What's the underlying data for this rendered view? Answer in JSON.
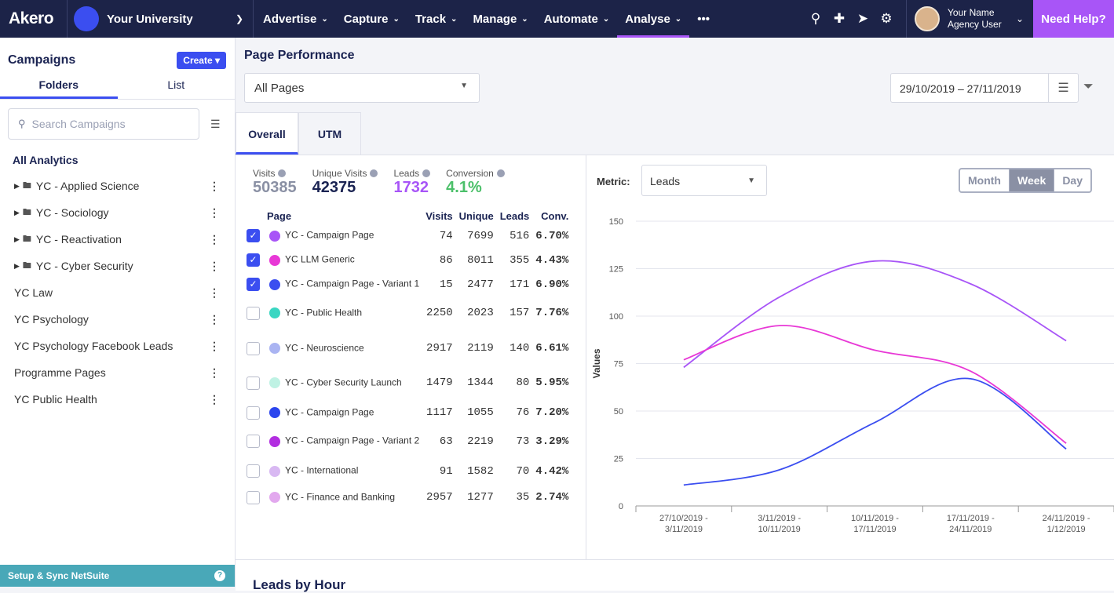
{
  "topbar": {
    "logo": "Akero",
    "org": "Your University",
    "nav": [
      "Advertise",
      "Capture",
      "Track",
      "Manage",
      "Automate",
      "Analyse"
    ],
    "more": "•••",
    "user_name": "Your Name",
    "user_role": "Agency User",
    "help": "Need Help?"
  },
  "sidebar": {
    "title": "Campaigns",
    "create": "Create ▾",
    "tabs": [
      "Folders",
      "List"
    ],
    "search_placeholder": "Search Campaigns",
    "all": "All Analytics",
    "folders": [
      "YC - Applied Science",
      "YC - Sociology",
      "YC - Reactivation",
      "YC - Cyber Security"
    ],
    "items": [
      "YC Law",
      "YC Psychology",
      "YC Psychology Facebook Leads",
      "Programme Pages",
      "YC Public Health"
    ],
    "footer": "Setup & Sync NetSuite"
  },
  "main": {
    "title": "Page Performance",
    "page_select": "All Pages",
    "date_range": "29/10/2019 – 27/11/2019",
    "tabs": [
      "Overall",
      "UTM"
    ],
    "stats": [
      {
        "label": "Visits",
        "value": "50385",
        "color": "#8a90a4"
      },
      {
        "label": "Unique Visits",
        "value": "42375",
        "color": "#1a2352"
      },
      {
        "label": "Leads",
        "value": "1732",
        "color": "#a855f7"
      },
      {
        "label": "Conversion",
        "value": "4.1%",
        "color": "#4cc06a"
      }
    ],
    "headers": [
      "Page",
      "Visits",
      "Unique",
      "Leads",
      "Conv."
    ],
    "rows": [
      {
        "checked": true,
        "color": "#a855f7",
        "page": "YC - Campaign Page",
        "visits": "74",
        "unique": "7699",
        "leads": "516",
        "conv": "6.70%"
      },
      {
        "checked": true,
        "color": "#e838d6",
        "page": "YC LLM Generic",
        "visits": "86",
        "unique": "8011",
        "leads": "355",
        "conv": "4.43%"
      },
      {
        "checked": true,
        "color": "#3b4ef0",
        "page": "YC - Campaign Page - Variant 1",
        "visits": "15",
        "unique": "2477",
        "leads": "171",
        "conv": "6.90%"
      },
      {
        "checked": false,
        "color": "#3ad6c2",
        "page": "YC - Public Health",
        "visits": "2250",
        "unique": "2023",
        "leads": "157",
        "conv": "7.76%"
      },
      {
        "checked": false,
        "color": "#aab4f2",
        "page": "YC - Neuroscience",
        "visits": "2917",
        "unique": "2119",
        "leads": "140",
        "conv": "6.61%"
      },
      {
        "checked": false,
        "color": "#bff2e4",
        "page": "YC - Cyber Security Launch",
        "visits": "1479",
        "unique": "1344",
        "leads": "80",
        "conv": "5.95%"
      },
      {
        "checked": false,
        "color": "#2b45ee",
        "page": "YC - Campaign Page",
        "visits": "1117",
        "unique": "1055",
        "leads": "76",
        "conv": "7.20%"
      },
      {
        "checked": false,
        "color": "#b22ee0",
        "page": "YC - Campaign Page - Variant 2",
        "visits": "63",
        "unique": "2219",
        "leads": "73",
        "conv": "3.29%"
      },
      {
        "checked": false,
        "color": "#d8b8f2",
        "page": "YC - International",
        "visits": "91",
        "unique": "1582",
        "leads": "70",
        "conv": "4.42%"
      },
      {
        "checked": false,
        "color": "#e2a8ee",
        "page": "YC - Finance and Banking",
        "visits": "2957",
        "unique": "1277",
        "leads": "35",
        "conv": "2.74%"
      }
    ],
    "metric_label": "Metric:",
    "metric": "Leads",
    "periods": [
      "Month",
      "Week",
      "Day"
    ],
    "active_period": "Week",
    "bottom_title": "Leads by Hour"
  },
  "chart_data": {
    "type": "line",
    "ylabel": "Values",
    "ylim": [
      0,
      150
    ],
    "yticks": [
      0,
      25,
      50,
      75,
      100,
      125,
      150
    ],
    "categories": [
      "27/10/2019 - 3/11/2019",
      "3/11/2019 - 10/11/2019",
      "10/11/2019 - 17/11/2019",
      "17/11/2019 - 24/11/2019",
      "24/11/2019 - 1/12/2019"
    ],
    "series": [
      {
        "color": "#a855f7",
        "values": [
          73,
          110,
          129,
          117,
          87
        ]
      },
      {
        "color": "#e838d6",
        "values": [
          77,
          95,
          82,
          71,
          33
        ]
      },
      {
        "color": "#3b4ef0",
        "values": [
          11,
          19,
          44,
          67,
          30
        ]
      }
    ]
  }
}
